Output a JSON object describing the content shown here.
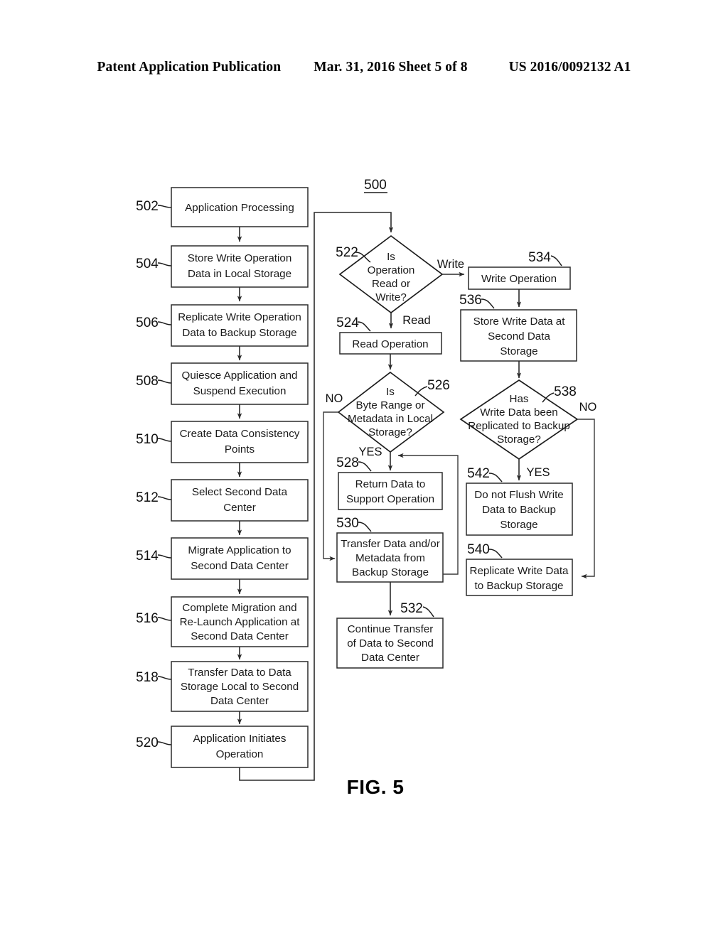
{
  "header": {
    "left": "Patent Application Publication",
    "middle": "Mar. 31, 2016  Sheet 5 of 8",
    "right": "US 2016/0092132 A1"
  },
  "figure": {
    "caption": "FIG. 5",
    "diagram_ref": "500"
  },
  "edge_labels": {
    "write": "Write",
    "read": "Read",
    "no_526": "NO",
    "yes_526": "YES",
    "no_538": "NO",
    "yes_538": "YES"
  },
  "nodes": {
    "n502": {
      "ref": "502",
      "shape": "box",
      "lines": [
        "Application Processing"
      ]
    },
    "n504": {
      "ref": "504",
      "shape": "box",
      "lines": [
        "Store Write Operation",
        "Data in Local Storage"
      ]
    },
    "n506": {
      "ref": "506",
      "shape": "box",
      "lines": [
        "Replicate Write Operation",
        "Data to Backup Storage"
      ]
    },
    "n508": {
      "ref": "508",
      "shape": "box",
      "lines": [
        "Quiesce Application and",
        "Suspend Execution"
      ]
    },
    "n510": {
      "ref": "510",
      "shape": "box",
      "lines": [
        "Create Data Consistency",
        "Points"
      ]
    },
    "n512": {
      "ref": "512",
      "shape": "box",
      "lines": [
        "Select Second Data",
        "Center"
      ]
    },
    "n514": {
      "ref": "514",
      "shape": "box",
      "lines": [
        "Migrate Application to",
        "Second Data Center"
      ]
    },
    "n516": {
      "ref": "516",
      "shape": "box",
      "lines": [
        "Complete Migration and",
        "Re-Launch Application at",
        "Second Data Center"
      ]
    },
    "n518": {
      "ref": "518",
      "shape": "box",
      "lines": [
        "Transfer Data to Data",
        "Storage Local to Second",
        "Data Center"
      ]
    },
    "n520": {
      "ref": "520",
      "shape": "box",
      "lines": [
        "Application Initiates",
        "Operation"
      ]
    },
    "n522": {
      "ref": "522",
      "shape": "diamond",
      "lines": [
        "Is",
        "Operation",
        "Read or",
        "Write?"
      ]
    },
    "n524": {
      "ref": "524",
      "shape": "box",
      "lines": [
        "Read Operation"
      ]
    },
    "n526": {
      "ref": "526",
      "shape": "diamond",
      "lines": [
        "Is",
        "Byte Range or",
        "Metadata in Local",
        "Storage?"
      ]
    },
    "n528": {
      "ref": "528",
      "shape": "box",
      "lines": [
        "Return Data to",
        "Support Operation"
      ]
    },
    "n530": {
      "ref": "530",
      "shape": "box",
      "lines": [
        "Transfer Data and/or",
        "Metadata from",
        "Backup Storage"
      ]
    },
    "n532": {
      "ref": "532",
      "shape": "box",
      "lines": [
        "Continue Transfer",
        "of Data to Second",
        "Data Center"
      ]
    },
    "n534": {
      "ref": "534",
      "shape": "box",
      "lines": [
        "Write Operation"
      ]
    },
    "n536": {
      "ref": "536",
      "shape": "box",
      "lines": [
        "Store Write Data at",
        "Second Data",
        "Storage"
      ]
    },
    "n538": {
      "ref": "538",
      "shape": "diamond",
      "lines": [
        "Has",
        "Write Data been",
        "Replicated to Backup",
        "Storage?"
      ]
    },
    "n540": {
      "ref": "540",
      "shape": "box",
      "lines": [
        "Replicate Write Data",
        "to Backup Storage"
      ]
    },
    "n542": {
      "ref": "542",
      "shape": "box",
      "lines": [
        "Do not Flush Write",
        "Data to Backup",
        "Storage"
      ]
    }
  }
}
